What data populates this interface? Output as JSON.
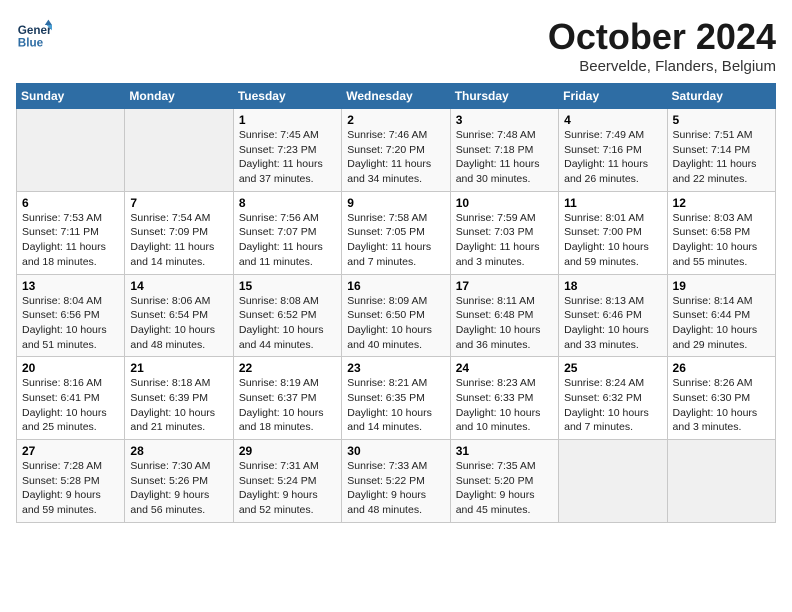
{
  "header": {
    "logo_line1": "General",
    "logo_line2": "Blue",
    "month": "October 2024",
    "location": "Beervelde, Flanders, Belgium"
  },
  "weekdays": [
    "Sunday",
    "Monday",
    "Tuesday",
    "Wednesday",
    "Thursday",
    "Friday",
    "Saturday"
  ],
  "weeks": [
    [
      {
        "day": "",
        "empty": true
      },
      {
        "day": "",
        "empty": true
      },
      {
        "day": "1",
        "sunrise": "7:45 AM",
        "sunset": "7:23 PM",
        "daylight": "11 hours and 37 minutes."
      },
      {
        "day": "2",
        "sunrise": "7:46 AM",
        "sunset": "7:20 PM",
        "daylight": "11 hours and 34 minutes."
      },
      {
        "day": "3",
        "sunrise": "7:48 AM",
        "sunset": "7:18 PM",
        "daylight": "11 hours and 30 minutes."
      },
      {
        "day": "4",
        "sunrise": "7:49 AM",
        "sunset": "7:16 PM",
        "daylight": "11 hours and 26 minutes."
      },
      {
        "day": "5",
        "sunrise": "7:51 AM",
        "sunset": "7:14 PM",
        "daylight": "11 hours and 22 minutes."
      }
    ],
    [
      {
        "day": "6",
        "sunrise": "7:53 AM",
        "sunset": "7:11 PM",
        "daylight": "11 hours and 18 minutes."
      },
      {
        "day": "7",
        "sunrise": "7:54 AM",
        "sunset": "7:09 PM",
        "daylight": "11 hours and 14 minutes."
      },
      {
        "day": "8",
        "sunrise": "7:56 AM",
        "sunset": "7:07 PM",
        "daylight": "11 hours and 11 minutes."
      },
      {
        "day": "9",
        "sunrise": "7:58 AM",
        "sunset": "7:05 PM",
        "daylight": "11 hours and 7 minutes."
      },
      {
        "day": "10",
        "sunrise": "7:59 AM",
        "sunset": "7:03 PM",
        "daylight": "11 hours and 3 minutes."
      },
      {
        "day": "11",
        "sunrise": "8:01 AM",
        "sunset": "7:00 PM",
        "daylight": "10 hours and 59 minutes."
      },
      {
        "day": "12",
        "sunrise": "8:03 AM",
        "sunset": "6:58 PM",
        "daylight": "10 hours and 55 minutes."
      }
    ],
    [
      {
        "day": "13",
        "sunrise": "8:04 AM",
        "sunset": "6:56 PM",
        "daylight": "10 hours and 51 minutes."
      },
      {
        "day": "14",
        "sunrise": "8:06 AM",
        "sunset": "6:54 PM",
        "daylight": "10 hours and 48 minutes."
      },
      {
        "day": "15",
        "sunrise": "8:08 AM",
        "sunset": "6:52 PM",
        "daylight": "10 hours and 44 minutes."
      },
      {
        "day": "16",
        "sunrise": "8:09 AM",
        "sunset": "6:50 PM",
        "daylight": "10 hours and 40 minutes."
      },
      {
        "day": "17",
        "sunrise": "8:11 AM",
        "sunset": "6:48 PM",
        "daylight": "10 hours and 36 minutes."
      },
      {
        "day": "18",
        "sunrise": "8:13 AM",
        "sunset": "6:46 PM",
        "daylight": "10 hours and 33 minutes."
      },
      {
        "day": "19",
        "sunrise": "8:14 AM",
        "sunset": "6:44 PM",
        "daylight": "10 hours and 29 minutes."
      }
    ],
    [
      {
        "day": "20",
        "sunrise": "8:16 AM",
        "sunset": "6:41 PM",
        "daylight": "10 hours and 25 minutes."
      },
      {
        "day": "21",
        "sunrise": "8:18 AM",
        "sunset": "6:39 PM",
        "daylight": "10 hours and 21 minutes."
      },
      {
        "day": "22",
        "sunrise": "8:19 AM",
        "sunset": "6:37 PM",
        "daylight": "10 hours and 18 minutes."
      },
      {
        "day": "23",
        "sunrise": "8:21 AM",
        "sunset": "6:35 PM",
        "daylight": "10 hours and 14 minutes."
      },
      {
        "day": "24",
        "sunrise": "8:23 AM",
        "sunset": "6:33 PM",
        "daylight": "10 hours and 10 minutes."
      },
      {
        "day": "25",
        "sunrise": "8:24 AM",
        "sunset": "6:32 PM",
        "daylight": "10 hours and 7 minutes."
      },
      {
        "day": "26",
        "sunrise": "8:26 AM",
        "sunset": "6:30 PM",
        "daylight": "10 hours and 3 minutes."
      }
    ],
    [
      {
        "day": "27",
        "sunrise": "7:28 AM",
        "sunset": "5:28 PM",
        "daylight": "9 hours and 59 minutes."
      },
      {
        "day": "28",
        "sunrise": "7:30 AM",
        "sunset": "5:26 PM",
        "daylight": "9 hours and 56 minutes."
      },
      {
        "day": "29",
        "sunrise": "7:31 AM",
        "sunset": "5:24 PM",
        "daylight": "9 hours and 52 minutes."
      },
      {
        "day": "30",
        "sunrise": "7:33 AM",
        "sunset": "5:22 PM",
        "daylight": "9 hours and 48 minutes."
      },
      {
        "day": "31",
        "sunrise": "7:35 AM",
        "sunset": "5:20 PM",
        "daylight": "9 hours and 45 minutes."
      },
      {
        "day": "",
        "empty": true
      },
      {
        "day": "",
        "empty": true
      }
    ]
  ]
}
